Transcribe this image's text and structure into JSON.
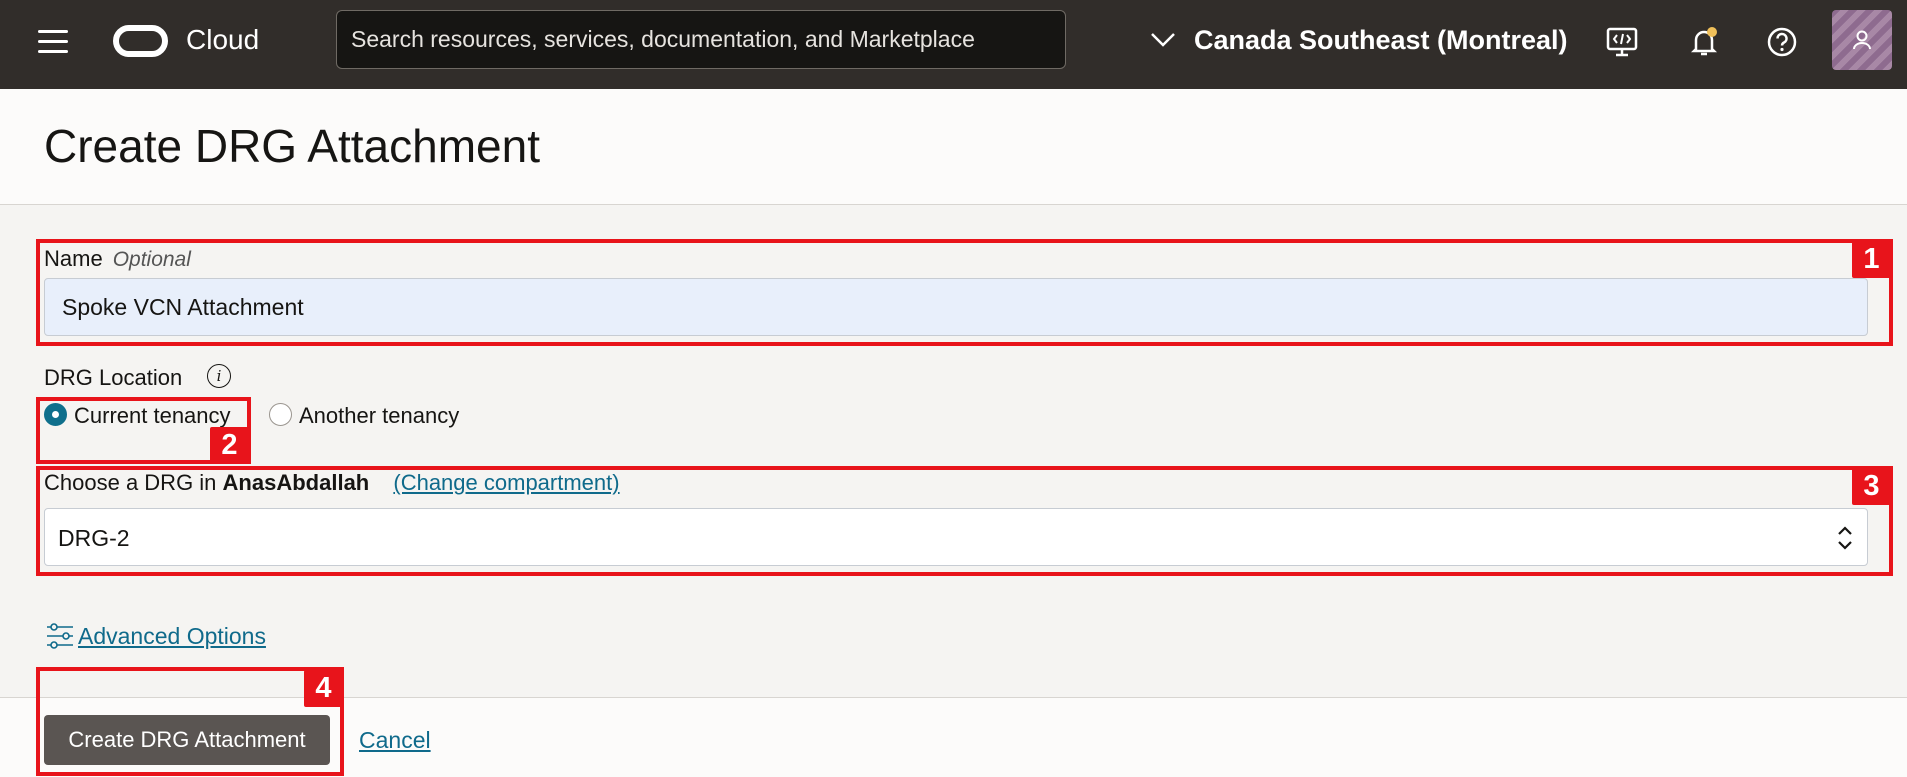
{
  "header": {
    "brand": "Cloud",
    "search_placeholder": "Search resources, services, documentation, and Marketplace",
    "region": "Canada Southeast (Montreal)"
  },
  "page": {
    "title": "Create DRG Attachment"
  },
  "form": {
    "name_label": "Name",
    "name_optional": "Optional",
    "name_value": "Spoke VCN Attachment",
    "location_label": "DRG Location",
    "location_options": [
      {
        "label": "Current tenancy",
        "checked": true
      },
      {
        "label": "Another tenancy",
        "checked": false
      }
    ],
    "drg_label_prefix": "Choose a DRG in",
    "drg_compartment": "AnasAbdallah",
    "change_compartment": "(Change compartment)",
    "drg_value": "DRG-2",
    "advanced_options": "Advanced Options"
  },
  "footer": {
    "create_button": "Create DRG Attachment",
    "cancel": "Cancel"
  },
  "annotations": [
    "1",
    "2",
    "3",
    "4"
  ]
}
